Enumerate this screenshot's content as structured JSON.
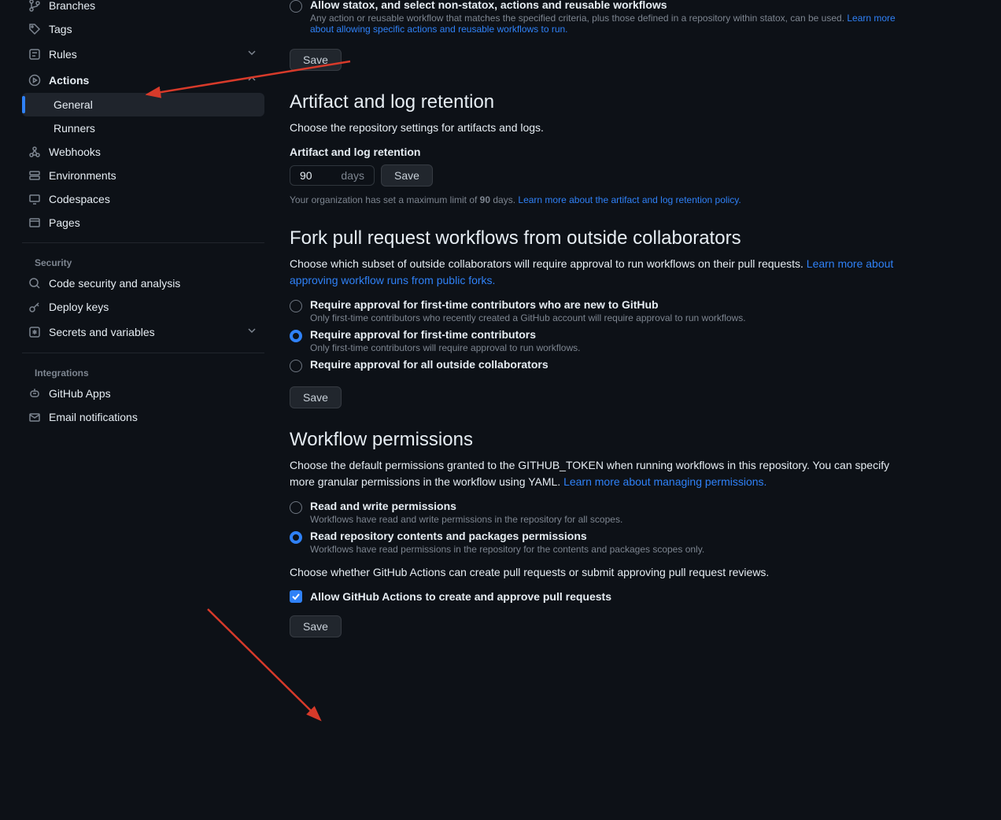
{
  "sidebar": {
    "items": {
      "branches": "Branches",
      "tags": "Tags",
      "rules": "Rules",
      "actions": "Actions",
      "general": "General",
      "runners": "Runners",
      "webhooks": "Webhooks",
      "environments": "Environments",
      "codespaces": "Codespaces",
      "pages": "Pages"
    },
    "security_heading": "Security",
    "security": {
      "code_security": "Code security and analysis",
      "deploy_keys": "Deploy keys",
      "secrets": "Secrets and variables"
    },
    "integrations_heading": "Integrations",
    "integrations": {
      "github_apps": "GitHub Apps",
      "email": "Email notifications"
    }
  },
  "permissions_top": {
    "allow_label": "Allow statox, and select non-statox, actions and reusable workflows",
    "allow_desc": "Any action or reusable workflow that matches the specified criteria, plus those defined in a repository within statox, can be used. ",
    "allow_link": "Learn more about allowing specific actions and reusable workflows to run.",
    "save": "Save"
  },
  "retention": {
    "title": "Artifact and log retention",
    "desc": "Choose the repository settings for artifacts and logs.",
    "label": "Artifact and log retention",
    "value": "90",
    "unit": "days",
    "save": "Save",
    "footer_pre": "Your organization has set a maximum limit of ",
    "footer_bold": "90",
    "footer_post": " days. ",
    "footer_link": "Learn more about the artifact and log retention policy."
  },
  "fork": {
    "title": "Fork pull request workflows from outside collaborators",
    "desc": "Choose which subset of outside collaborators will require approval to run workflows on their pull requests. ",
    "link": "Learn more about approving workflow runs from public forks.",
    "opt1_label": "Require approval for first-time contributors who are new to GitHub",
    "opt1_desc": "Only first-time contributors who recently created a GitHub account will require approval to run workflows.",
    "opt2_label": "Require approval for first-time contributors",
    "opt2_desc": "Only first-time contributors will require approval to run workflows.",
    "opt3_label": "Require approval for all outside collaborators",
    "save": "Save"
  },
  "workflow": {
    "title": "Workflow permissions",
    "desc": "Choose the default permissions granted to the GITHUB_TOKEN when running workflows in this repository. You can specify more granular permissions in the workflow using YAML. ",
    "link": "Learn more about managing permissions.",
    "opt1_label": "Read and write permissions",
    "opt1_desc": "Workflows have read and write permissions in the repository for all scopes.",
    "opt2_label": "Read repository contents and packages permissions",
    "opt2_desc": "Workflows have read permissions in the repository for the contents and packages scopes only.",
    "pr_desc": "Choose whether GitHub Actions can create pull requests or submit approving pull request reviews.",
    "checkbox_label": "Allow GitHub Actions to create and approve pull requests",
    "save": "Save"
  }
}
